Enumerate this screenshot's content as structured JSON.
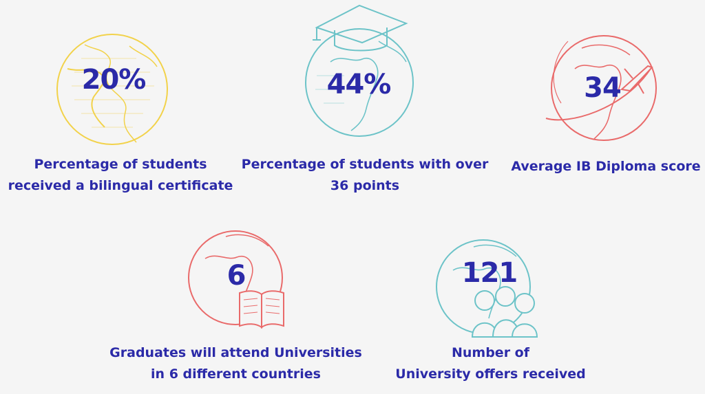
{
  "stats": [
    {
      "value": "20%",
      "caption_line1": "Percentage of students",
      "caption_line2": "received a bilingual certificate",
      "color": "#f2d24a",
      "icon": "globe-icon"
    },
    {
      "value": "44%",
      "caption_line1": "Percentage of students with over",
      "caption_line2": "36 points",
      "color": "#6cc3c8",
      "icon": "graduation-cap-icon"
    },
    {
      "value": "34",
      "caption_line1": "Average IB Diploma score",
      "caption_line2": "",
      "color": "#e96a6a",
      "icon": "airplane-icon"
    },
    {
      "value": "6",
      "caption_line1": "Graduates will attend Universities",
      "caption_line2": "in 6 different countries",
      "color": "#e96a6a",
      "icon": "open-book-icon"
    },
    {
      "value": "121",
      "caption_line1": "Number of",
      "caption_line2": "University offers received",
      "color": "#6cc3c8",
      "icon": "people-icon"
    }
  ],
  "colors": {
    "text": "#2b2aa8",
    "background": "#f5f5f5"
  }
}
